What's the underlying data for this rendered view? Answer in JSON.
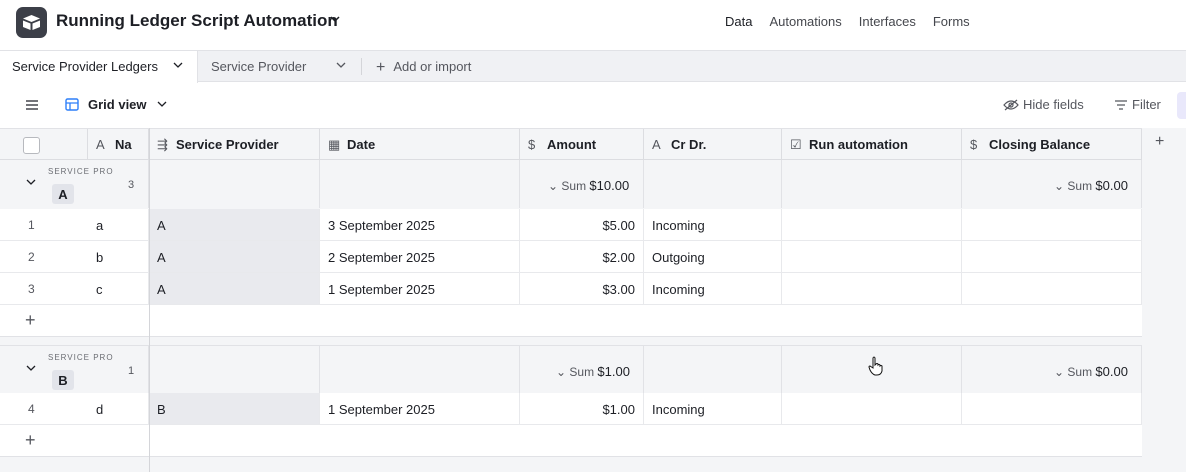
{
  "app": {
    "title": "Running Ledger Script Automation"
  },
  "nav": {
    "data": "Data",
    "automations": "Automations",
    "interfaces": "Interfaces",
    "forms": "Forms"
  },
  "tabs": {
    "active": "Service Provider Ledgers",
    "second": "Service Provider",
    "add": "Add or import"
  },
  "view": {
    "name": "Grid view",
    "hide_fields": "Hide fields",
    "filter": "Filter"
  },
  "columns": {
    "name": "Na",
    "service_provider": "Service Provider",
    "date": "Date",
    "amount": "Amount",
    "cr_dr": "Cr Dr.",
    "run_automation": "Run automation",
    "closing_balance": "Closing Balance"
  },
  "groups": [
    {
      "label": "SERVICE PRO",
      "value": "A",
      "count": "3",
      "amount_sum": "$10.00",
      "closing_sum": "$0.00",
      "sum_label": "Sum",
      "rows": [
        {
          "num": "1",
          "name": "a",
          "provider": "A",
          "date": "3 September 2025",
          "amount": "$5.00",
          "crdr": "Incoming"
        },
        {
          "num": "2",
          "name": "b",
          "provider": "A",
          "date": "2 September 2025",
          "amount": "$2.00",
          "crdr": "Outgoing"
        },
        {
          "num": "3",
          "name": "c",
          "provider": "A",
          "date": "1 September 2025",
          "amount": "$3.00",
          "crdr": "Incoming"
        }
      ]
    },
    {
      "label": "SERVICE PRO",
      "value": "B",
      "count": "1",
      "amount_sum": "$1.00",
      "closing_sum": "$0.00",
      "sum_label": "Sum",
      "rows": [
        {
          "num": "4",
          "name": "d",
          "provider": "B",
          "date": "1 September 2025",
          "amount": "$1.00",
          "crdr": "Incoming"
        }
      ]
    }
  ],
  "icons": {
    "logo": "airtable-logo-icon",
    "grid": "grid-view-icon",
    "hide": "eye-off-icon",
    "filter": "filter-icon"
  },
  "colors": {
    "grid_icon": "#2d7ff9",
    "view_accent": "#e9e8fb"
  }
}
